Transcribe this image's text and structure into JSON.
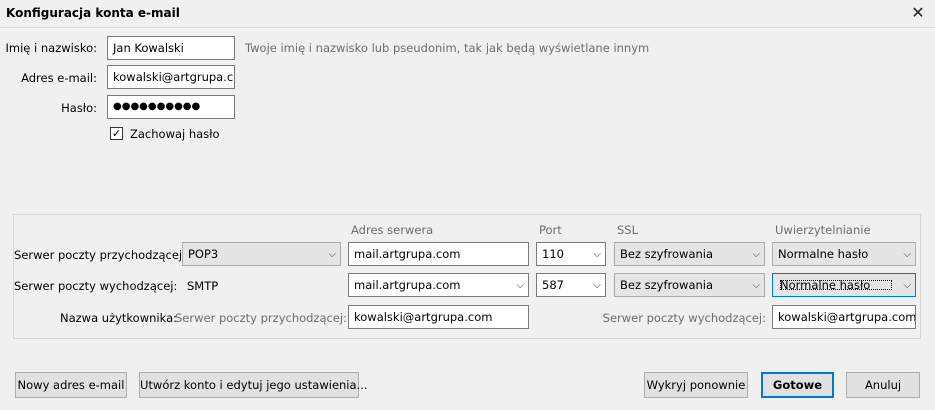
{
  "window": {
    "title": "Konfiguracja konta e-mail",
    "close_icon": "✕"
  },
  "identity": {
    "name_label": "Imię i nazwisko:",
    "name_value": "Jan Kowalski",
    "name_hint": "Twoje imię i nazwisko lub pseudonim, tak jak będą wyświetlane innym",
    "email_label": "Adres e-mail:",
    "email_value": "kowalski@artgrupa.com",
    "password_label": "Hasło:",
    "password_value": "●●●●●●●●●●",
    "remember_label": "Zachowaj hasło",
    "remember_checked": true,
    "check_icon": "✓"
  },
  "servers": {
    "headers": {
      "address": "Adres serwera",
      "port": "Port",
      "ssl": "SSL",
      "auth": "Uwierzytelnianie"
    },
    "incoming": {
      "label": "Serwer poczty przychodzącej:",
      "protocol": "POP3",
      "address": "mail.artgrupa.com",
      "port": "110",
      "ssl": "Bez szyfrowania",
      "auth": "Normalne hasło"
    },
    "outgoing": {
      "label": "Serwer poczty wychodzącej:",
      "protocol": "SMTP",
      "address": "mail.artgrupa.com",
      "port": "587",
      "ssl": "Bez szyfrowania",
      "auth": "Normalne hasło"
    },
    "username": {
      "label": "Nazwa użytkownika:",
      "incoming_label": "Serwer poczty przychodzącej:",
      "incoming_value": "kowalski@artgrupa.com",
      "outgoing_label": "Serwer poczty wychodzącej:",
      "outgoing_value": "kowalski@artgrupa.com"
    },
    "chevron_icon": "⌵"
  },
  "buttons": {
    "new_address": "Nowy adres e-mail",
    "create_edit": "Utwórz konto i edytuj jego ustawienia...",
    "redetect": "Wykryj ponownie",
    "done": "Gotowe",
    "cancel": "Anuluj"
  }
}
